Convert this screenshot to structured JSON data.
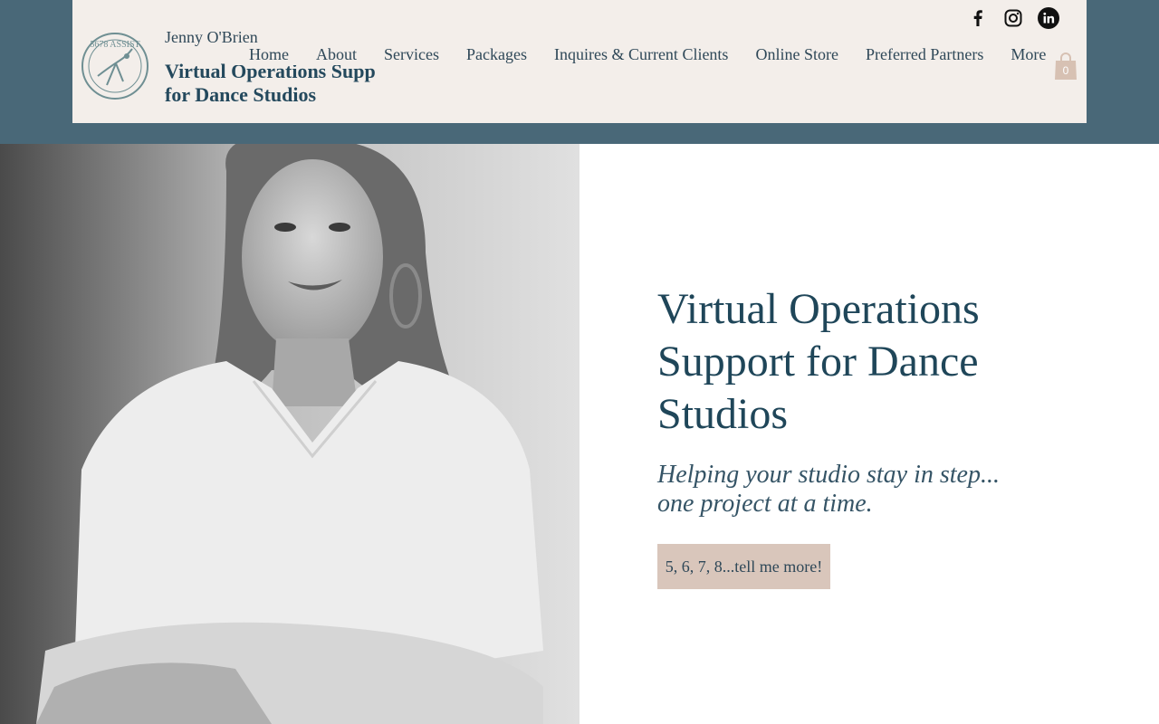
{
  "site": {
    "owner_name": "Jenny O'Brien",
    "tagline": "Virtual Operations Supp\nfor Dance Studios",
    "logo_text": "5678 ASSIST"
  },
  "nav": {
    "items": [
      {
        "label": "Home"
      },
      {
        "label": "About"
      },
      {
        "label": "Services"
      },
      {
        "label": "Packages"
      },
      {
        "label": "Inquires & Current Clients"
      },
      {
        "label": "Online Store"
      },
      {
        "label": "Preferred Partners"
      },
      {
        "label": "More"
      }
    ]
  },
  "socials": [
    {
      "icon": "facebook-icon"
    },
    {
      "icon": "instagram-icon"
    },
    {
      "icon": "linkedin-icon"
    }
  ],
  "cart": {
    "count": "0",
    "icon": "shopping-bag-icon"
  },
  "hero": {
    "heading": "Virtual Operations Support for Dance Studios",
    "subheading": "Helping your studio stay in step...\none project at a time.",
    "cta_label": "5, 6, 7, 8...tell me more!"
  },
  "colors": {
    "band": "#496878",
    "header_bg": "#f3eeea",
    "heading": "#1f4659",
    "cta_bg": "#d9c6bb"
  }
}
